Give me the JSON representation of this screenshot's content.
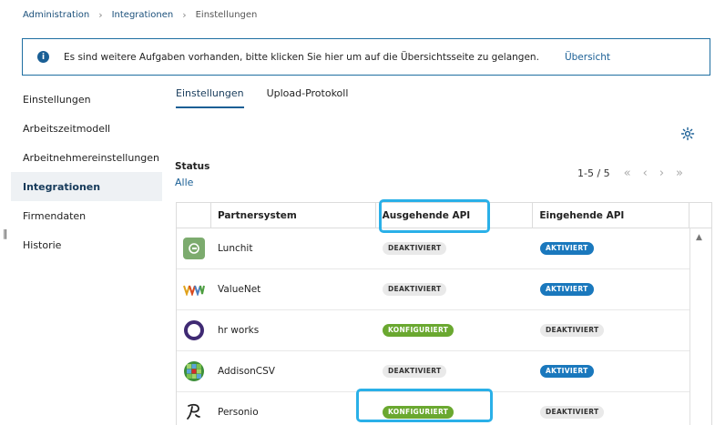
{
  "breadcrumb": {
    "items": [
      "Administration",
      "Integrationen",
      "Einstellungen"
    ]
  },
  "banner": {
    "text": "Es sind weitere Aufgaben vorhanden, bitte klicken Sie hier um auf die Übersichtsseite zu gelangen.",
    "link": "Übersicht"
  },
  "sidebar": {
    "items": [
      {
        "label": "Einstellungen"
      },
      {
        "label": "Arbeitszeitmodell"
      },
      {
        "label": "Arbeitnehmereinstellungen"
      },
      {
        "label": "Integrationen"
      },
      {
        "label": "Firmendaten"
      },
      {
        "label": "Historie"
      }
    ]
  },
  "tabs": [
    {
      "label": "Einstellungen"
    },
    {
      "label": "Upload-Protokoll"
    }
  ],
  "filter": {
    "status_label": "Status",
    "status_value": "Alle"
  },
  "pager": {
    "range": "1-5 / 5"
  },
  "table": {
    "headers": [
      "Partnersystem",
      "Ausgehende API",
      "Eingehende API"
    ],
    "rows": [
      {
        "partner": "Lunchit",
        "out": "DEAKTIVIERT",
        "in": "AKTIVIERT"
      },
      {
        "partner": "ValueNet",
        "out": "DEAKTIVIERT",
        "in": "AKTIVIERT"
      },
      {
        "partner": "hr works",
        "out": "KONFIGURIERT",
        "in": "DEAKTIVIERT"
      },
      {
        "partner": "AddisonCSV",
        "out": "DEAKTIVIERT",
        "in": "AKTIVIERT"
      },
      {
        "partner": "Personio",
        "out": "KONFIGURIERT",
        "in": "DEAKTIVIERT"
      }
    ]
  },
  "colors": {
    "accent": "#1a5f95",
    "highlight": "#2ab0e8",
    "badge_active": "#1a78bd",
    "badge_configured": "#6aa830",
    "badge_inactive": "#e9e9e9"
  }
}
